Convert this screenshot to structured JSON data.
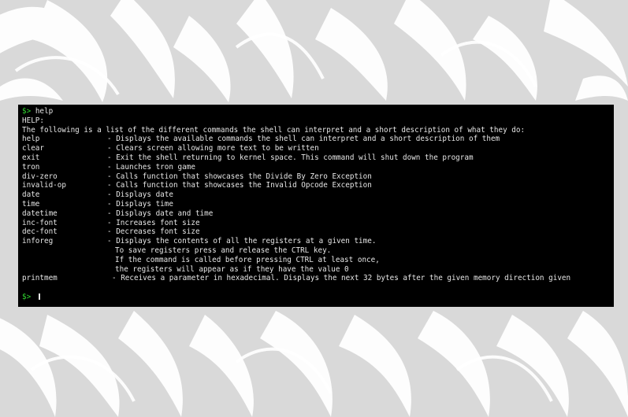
{
  "terminal": {
    "prompt": "$>",
    "command": "help",
    "header": "HELP:",
    "intro": "The following is a list of the different commands the shell can interpret and a short description of what they do:",
    "entries": [
      {
        "cmd": "help",
        "desc": "- Displays the available commands the shell can interpret and a short description of them"
      },
      {
        "cmd": "clear",
        "desc": "- Clears screen allowing more text to be written"
      },
      {
        "cmd": "exit",
        "desc": "- Exit the shell returning to kernel space. This command will shut down the program"
      },
      {
        "cmd": "tron",
        "desc": "- Launches tron game"
      },
      {
        "cmd": "div-zero",
        "desc": "- Calls function that showcases the Divide By Zero Exception"
      },
      {
        "cmd": "invalid-op",
        "desc": "- Calls function that showcases the Invalid Opcode Exception"
      },
      {
        "cmd": "date",
        "desc": "- Displays date"
      },
      {
        "cmd": "time",
        "desc": "- Displays time"
      },
      {
        "cmd": "datetime",
        "desc": "- Displays date and time"
      },
      {
        "cmd": "inc-font",
        "desc": "- Increases font size"
      },
      {
        "cmd": "dec-font",
        "desc": "- Decreases font size"
      },
      {
        "cmd": "inforeg",
        "desc": "- Displays the contents of all the registers at a given time."
      }
    ],
    "inforeg_continuation": [
      "To save registers press and release the CTRL key.",
      "If the command is called before pressing CTRL at least once,",
      "the registers will appear as if they have the value 0"
    ],
    "printmem": {
      "cmd": "printmem",
      "desc": "- Receives a parameter in hexadecimal. Displays the next 32 bytes after the given memory direction given"
    },
    "input_prompt": "$>",
    "input_value": ""
  },
  "colors": {
    "prompt": "#2fd62f",
    "text": "#e6e6e6",
    "terminal_bg": "#000000",
    "backdrop": "#dcdcdc"
  }
}
